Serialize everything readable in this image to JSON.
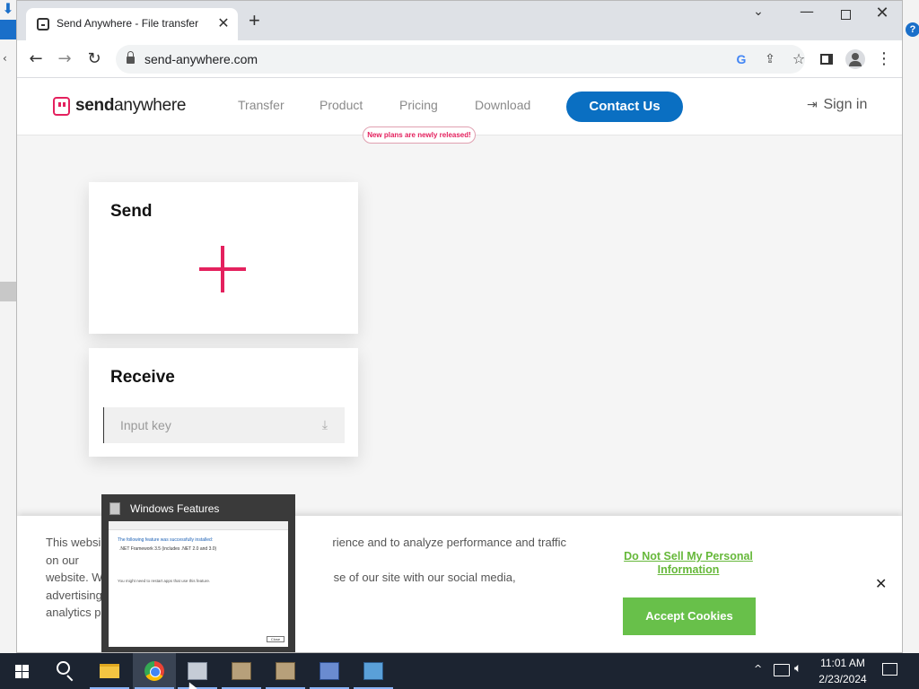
{
  "browser": {
    "tab_title": "Send Anywhere - File transfer",
    "tab_close": "✕",
    "new_tab": "+",
    "url": "send-anywhere.com",
    "google_icon_letter": "G",
    "controls": {
      "minimize": "—",
      "close": "✕",
      "tab_search": "⌄"
    }
  },
  "site": {
    "logo_prefix": "send",
    "logo_suffix": "anywhere",
    "nav": [
      "Transfer",
      "Product",
      "Pricing",
      "Download"
    ],
    "pricing_badge": "New plans are newly released!",
    "contact_label": "Contact Us",
    "signin_label": "Sign in"
  },
  "send_card": {
    "title": "Send"
  },
  "receive_card": {
    "title": "Receive",
    "input_placeholder": "Input key"
  },
  "cookie_banner": {
    "text_visible_1": "This websi",
    "text_visible_2": "rience and to analyze performance and traffic on our",
    "text_visible_3": "website. W",
    "text_visible_4": "se of our site with our social media, advertising and",
    "text_visible_5": "analytics pa",
    "dnsmpi_link": "Do Not Sell My Personal Information",
    "accept_label": "Accept Cookies",
    "close_label": "✕"
  },
  "taskbar_preview": {
    "title": "Windows Features",
    "line1": "The following feature was successfully installed:",
    "line2": ".NET Framework 3.5 (includes .NET 2.0 and 3.0)",
    "line3": "You might need to restart apps that use this feature.",
    "button": "Close"
  },
  "taskbar": {
    "time": "11:01 AM",
    "date": "2/23/2024",
    "tray_overflow": "^"
  },
  "colors": {
    "brand_pink": "#e4215e",
    "brand_blue": "#0a6fc2",
    "cookie_green": "#68c04a"
  }
}
